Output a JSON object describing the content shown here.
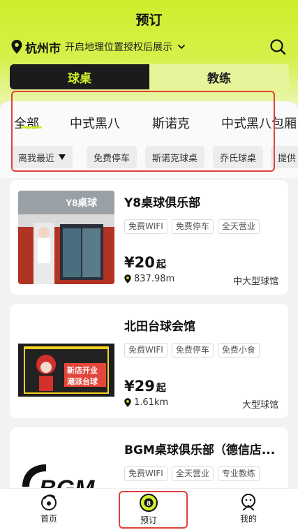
{
  "page_title": "预订",
  "location": {
    "city": "杭州市",
    "hint": "开启地理位置授权后展示"
  },
  "segments": [
    "球桌",
    "教练"
  ],
  "category_tabs": [
    "全部",
    "中式黑八",
    "斯诺克",
    "中式黑八包厢"
  ],
  "filters": {
    "sort": "离我最近",
    "chips": [
      "免费停车",
      "斯诺克球桌",
      "乔氏球桌",
      "提供"
    ]
  },
  "venues": [
    {
      "name": "Y8桌球俱乐部",
      "tags": [
        "免费WIFI",
        "免费停车",
        "全天营业"
      ],
      "price": "¥20",
      "price_suffix": "起",
      "distance": "837.98m",
      "size": "中大型球馆",
      "image_text": "Y8桌球"
    },
    {
      "name": "北田台球会馆",
      "tags": [
        "免费WIFI",
        "免费停车",
        "免费小食"
      ],
      "price": "¥29",
      "price_suffix": "起",
      "distance": "1.61km",
      "size": "大型球馆",
      "image_text_1": "新店开业",
      "image_text_2": "潮派台球"
    },
    {
      "name": "BGM桌球俱乐部（德信店...",
      "tags": [
        "免费WIFI",
        "全天营业",
        "专业教练"
      ],
      "image_text": "BGM"
    }
  ],
  "tabbar": [
    "首页",
    "预订",
    "我的"
  ],
  "colors": {
    "accent": "#d4f02c",
    "dark": "#1b1b1b",
    "highlight": "#e0413a"
  }
}
